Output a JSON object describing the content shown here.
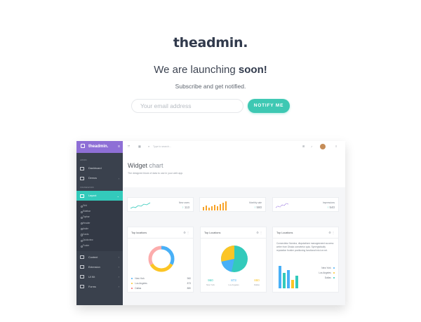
{
  "landing": {
    "logo": "theadmin.",
    "headline_pre": "We are launching ",
    "headline_bold": "soon!",
    "subtitle": "Subscribe and get notified.",
    "email_placeholder": "Your email address",
    "notify_label": "NOTIFY ME",
    "accent_color": "#3ec8b3"
  },
  "preview": {
    "sidebar": {
      "brand": "theadmin.",
      "caption_1": "ADMIN",
      "caption_2": "FRAMEWORK",
      "items": [
        {
          "label": "Dashboard",
          "icon": "home-icon",
          "has_arrow": false
        },
        {
          "label": "Demos",
          "icon": "monitor-icon",
          "has_arrow": true
        },
        {
          "label": "Layout",
          "icon": "layout-icon",
          "has_arrow": true,
          "active": true
        }
      ],
      "submenu": [
        "Grid",
        "Sidebar",
        "Topbar",
        "Header",
        "Aside",
        "Cards",
        "Quickview",
        "Footer"
      ],
      "bottom_items": [
        {
          "label": "Content",
          "icon": "list-icon"
        },
        {
          "label": "Extension",
          "icon": "puzzle-icon"
        },
        {
          "label": "UI Kit",
          "icon": "kit-icon"
        },
        {
          "label": "Forms",
          "icon": "check-icon"
        }
      ]
    },
    "topbar": {
      "search_placeholder": "Type to search..."
    },
    "header": {
      "title_a": "Widget ",
      "title_b": "chart",
      "description": "The designed block of data to use in your web app."
    },
    "stats": [
      {
        "label": "New users",
        "value": "113",
        "color": "#33cabb"
      },
      {
        "label": "Monthly sale",
        "value": "580",
        "color": "#f7a328"
      },
      {
        "label": "Impressions",
        "value": "540",
        "color": "#926dde"
      }
    ],
    "cards": [
      {
        "title": "Top locations",
        "legend": [
          {
            "name": "New York",
            "value": "960",
            "color": "#48b0f7"
          },
          {
            "name": "Los Angeles",
            "value": "873",
            "color": "#fcc525"
          },
          {
            "name": "Dallas",
            "value": "880",
            "color": "#f96868"
          }
        ]
      },
      {
        "title": "Top Locations",
        "numbers": [
          {
            "value": "960",
            "label": "New York",
            "color": "#33cabb"
          },
          {
            "value": "873",
            "label": "Los Angeles",
            "color": "#48b0f7"
          },
          {
            "value": "880",
            "label": "Dallas",
            "color": "#fcc525"
          }
        ]
      },
      {
        "title": "Top Locations",
        "description": "Consectetur Nomina, disputatione managewnent success writer from Dhaka consetetur quia. Synergistically reputation frontier positioning functional into ice net.",
        "legend": [
          {
            "name": "New York",
            "color": "#48b0f7"
          },
          {
            "name": "Los Angeles",
            "color": "#fcc525"
          },
          {
            "name": "Dallas",
            "color": "#33cabb"
          }
        ]
      }
    ]
  }
}
